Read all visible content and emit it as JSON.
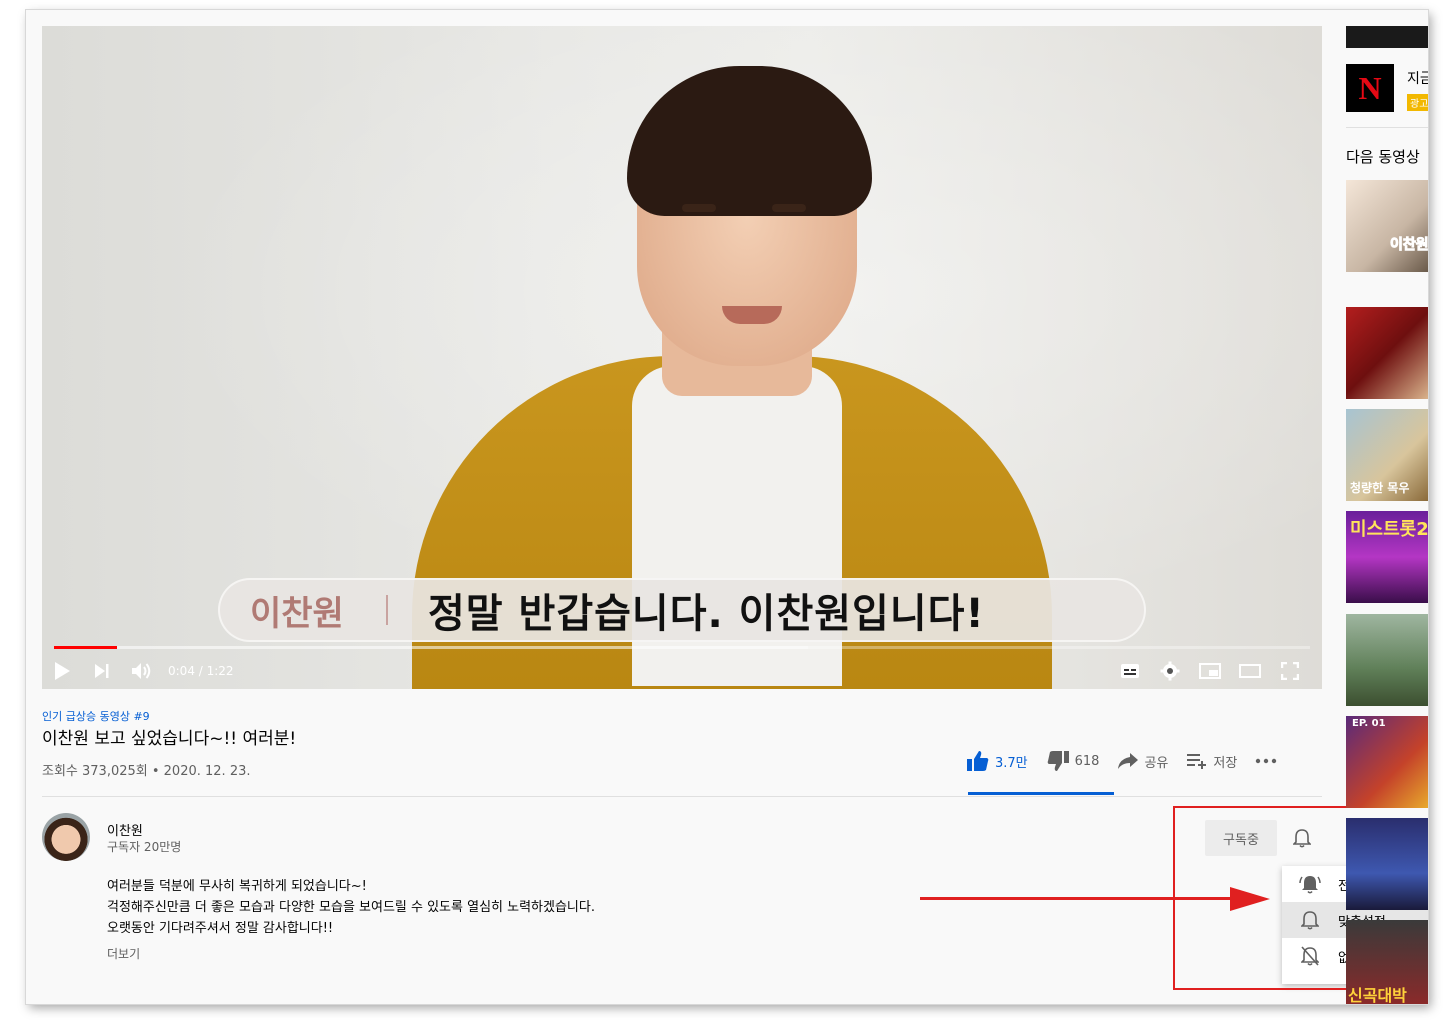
{
  "player": {
    "caption_name": "이찬원",
    "caption_text": "정말 반갑습니다. 이찬원입니다!",
    "time": "0:04 / 1:22",
    "progress_played": 0.05,
    "progress_buffered": 0.6
  },
  "video": {
    "trending_tag": "인기 급상승 동영상 #9",
    "title": "이찬원 보고 싶었습니다~!! 여러분!",
    "meta": "조회수 373,025회 • 2020. 12. 23.",
    "likes": "3.7만",
    "dislikes": "618",
    "share_label": "공유",
    "save_label": "저장"
  },
  "channel": {
    "name": "이찬원",
    "subscribers": "구독자 20만명",
    "subscribed_label": "구독중"
  },
  "description": {
    "lines": [
      "여러분들 덕분에 무사히 복귀하게 되었습니다~!",
      "걱정해주신만큼 더 좋은 모습과 다양한 모습을 보여드릴 수 있도록 열심히 노력하겠습니다.",
      "오랫동안 기다려주셔서 정말 감사합니다!!"
    ],
    "more_label": "더보기"
  },
  "notification_menu": {
    "items": [
      {
        "label": "전체",
        "icon": "bell-ringing-icon"
      },
      {
        "label": "맞춤설정",
        "icon": "bell-icon"
      },
      {
        "label": "없음",
        "icon": "bell-off-icon"
      }
    ],
    "selected_index": 1
  },
  "sidebar": {
    "ad_text": "지금",
    "ad_badge": "광고",
    "next_label": "다음 동영상",
    "thumbs": [
      {
        "text": "이찬원"
      },
      {
        "text": ""
      },
      {
        "text": "청량한 목우"
      },
      {
        "text": "미스트롯2"
      },
      {
        "text": ""
      },
      {
        "text": "EP. 01"
      },
      {
        "text": ""
      },
      {
        "text": "신곡대박"
      }
    ]
  },
  "colors": {
    "accent_blue": "#065fd4",
    "youtube_red": "#ff0000",
    "annotation_red": "#e02020"
  }
}
